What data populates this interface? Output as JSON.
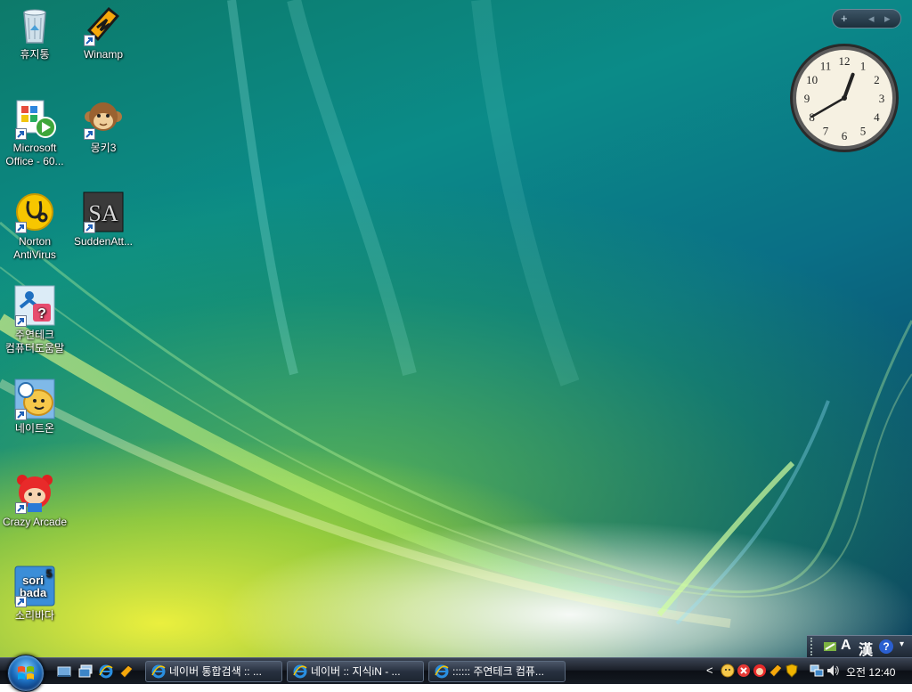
{
  "desktop": {
    "icons": [
      {
        "label": "휴지통",
        "icon": "recycle-bin-icon"
      },
      {
        "label": "Winamp",
        "icon": "winamp-icon"
      },
      {
        "label": "Microsoft Office - 60...",
        "icon": "office-icon"
      },
      {
        "label": "몽키3",
        "icon": "monkey-icon"
      },
      {
        "label": "Norton AntiVirus",
        "icon": "norton-icon"
      },
      {
        "label": "SuddenAtt...",
        "icon": "sudden-attack-icon"
      },
      {
        "label": "주연테크 컴퓨터도움말",
        "icon": "help-icon"
      },
      {
        "label": "네이트온",
        "icon": "nateon-icon"
      },
      {
        "label": "Crazy Arcade",
        "icon": "crazy-arcade-icon"
      },
      {
        "label": "소리바다",
        "icon": "soribada-icon"
      }
    ]
  },
  "sidebar": {
    "add_label": "+",
    "prev_label": "◂",
    "next_label": "▸",
    "clock": {
      "hour": 12,
      "minute": 40
    }
  },
  "language_bar": {
    "mode_label": "A",
    "hanja_label": "漢",
    "help_label": "?"
  },
  "taskbar": {
    "tasks": [
      {
        "label": "네이버 통합검색 :: ..."
      },
      {
        "label": "네이버 :: 지식iN - ..."
      },
      {
        "label": ":::::: 주연테크 컴퓨..."
      }
    ],
    "tray_expand_label": "<",
    "clock_text": "오전 12:40"
  },
  "colors": {
    "taskbar": "#141a22",
    "desktop_teal": "#0b8b88",
    "desktop_yellow": "#f0f03c"
  }
}
